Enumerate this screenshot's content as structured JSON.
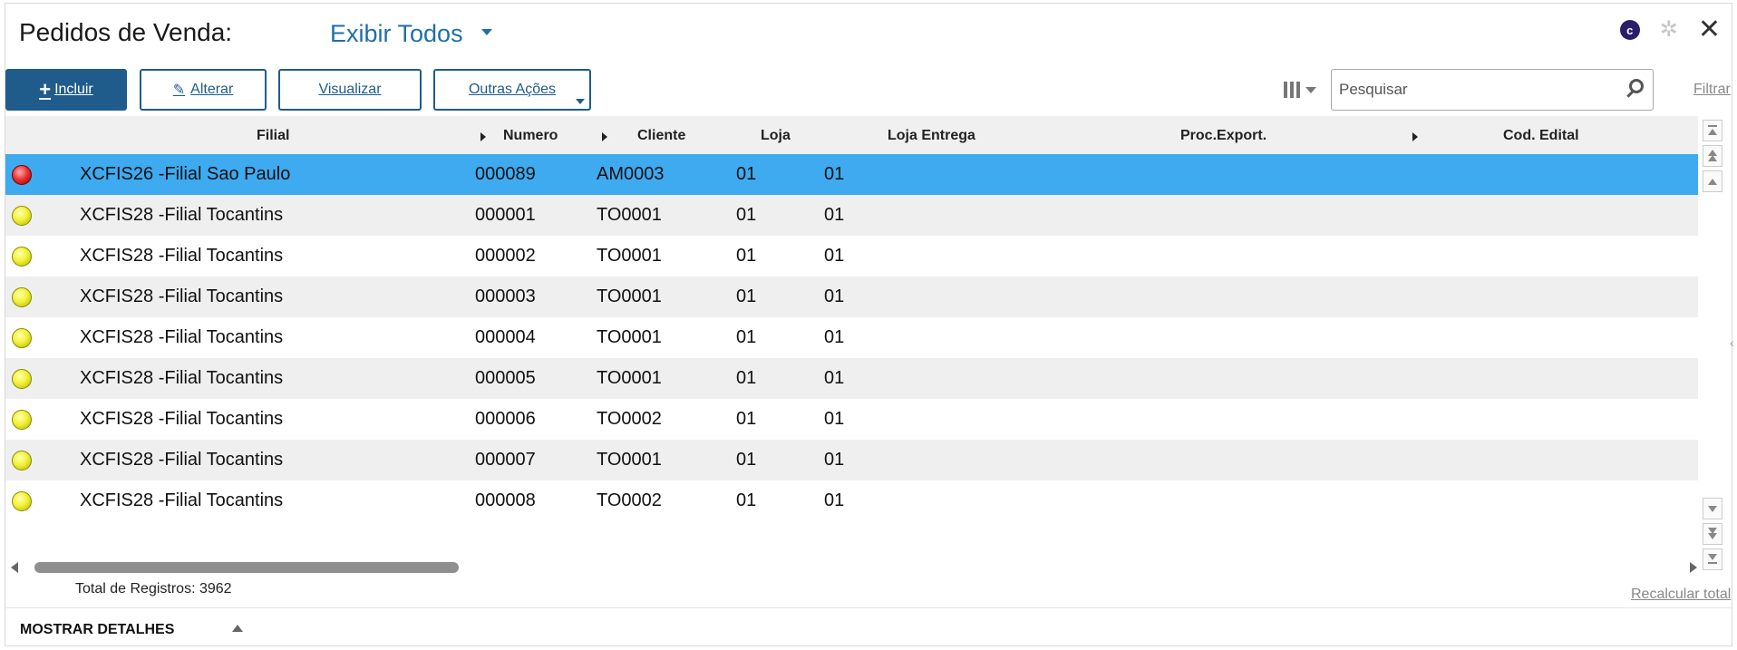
{
  "header": {
    "title": "Pedidos de Venda:",
    "view": "Exibir Todos",
    "icons": [
      "c-brand-icon",
      "gear-icon",
      "close-icon"
    ],
    "brand_letter": "c",
    "gear_glyph": "✲",
    "close_glyph": "✕"
  },
  "toolbar": {
    "incluir": "Incluir",
    "alterar": "Alterar",
    "visualizar": "Visualizar",
    "outras_acoes": "Outras Ações",
    "search_placeholder": "Pesquisar",
    "filtrar": "Filtrar"
  },
  "grid": {
    "columns": [
      "Filial",
      "Numero",
      "Cliente",
      "Loja",
      "Loja Entrega",
      "Proc.Export.",
      "Cod. Edital"
    ],
    "rows": [
      {
        "status": "red",
        "filial": "XCFIS26 -Filial Sao Paulo",
        "numero": "000089",
        "cliente": "AM0003",
        "loja": "01",
        "loja_entrega": "01"
      },
      {
        "status": "yellow",
        "filial": "XCFIS28 -Filial Tocantins",
        "numero": "000001",
        "cliente": "TO0001",
        "loja": "01",
        "loja_entrega": "01"
      },
      {
        "status": "yellow",
        "filial": "XCFIS28 -Filial Tocantins",
        "numero": "000002",
        "cliente": "TO0001",
        "loja": "01",
        "loja_entrega": "01"
      },
      {
        "status": "yellow",
        "filial": "XCFIS28 -Filial Tocantins",
        "numero": "000003",
        "cliente": "TO0001",
        "loja": "01",
        "loja_entrega": "01"
      },
      {
        "status": "yellow",
        "filial": "XCFIS28 -Filial Tocantins",
        "numero": "000004",
        "cliente": "TO0001",
        "loja": "01",
        "loja_entrega": "01"
      },
      {
        "status": "yellow",
        "filial": "XCFIS28 -Filial Tocantins",
        "numero": "000005",
        "cliente": "TO0001",
        "loja": "01",
        "loja_entrega": "01"
      },
      {
        "status": "yellow",
        "filial": "XCFIS28 -Filial Tocantins",
        "numero": "000006",
        "cliente": "TO0002",
        "loja": "01",
        "loja_entrega": "01"
      },
      {
        "status": "yellow",
        "filial": "XCFIS28 -Filial Tocantins",
        "numero": "000007",
        "cliente": "TO0001",
        "loja": "01",
        "loja_entrega": "01"
      },
      {
        "status": "yellow",
        "filial": "XCFIS28 -Filial Tocantins",
        "numero": "000008",
        "cliente": "TO0002",
        "loja": "01",
        "loja_entrega": "01"
      }
    ],
    "selected_row": 0
  },
  "footer": {
    "total": "Total de Registros: 3962",
    "recalcular": "Recalcular total",
    "details": "MOSTRAR DETALHES"
  },
  "colors": {
    "primary": "#1f5c8c",
    "selected_row": "#3eaaf0",
    "stripe": "#efefef",
    "link": "#1f6fa8"
  }
}
